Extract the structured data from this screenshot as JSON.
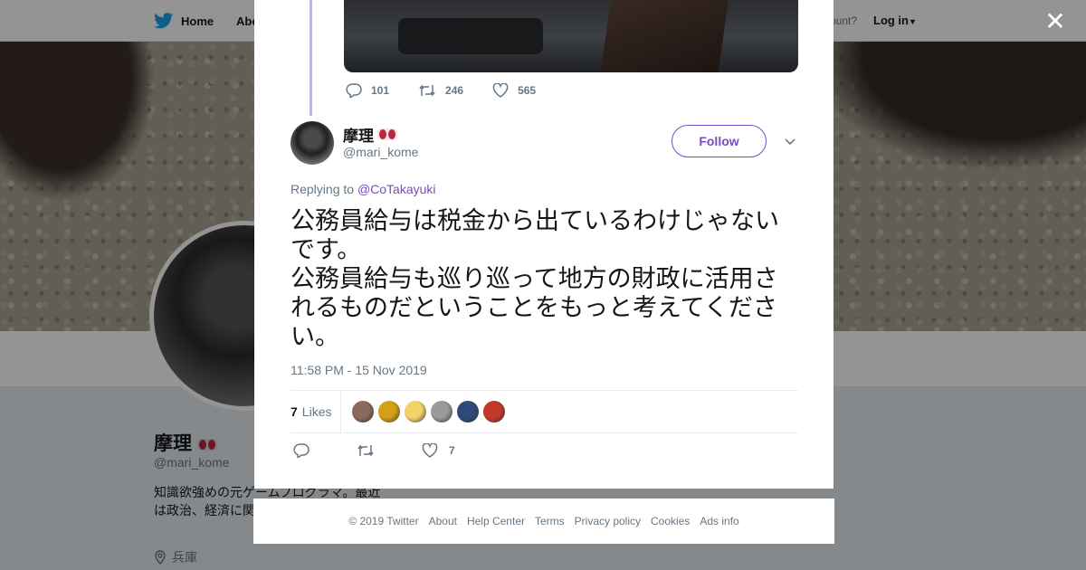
{
  "topbar": {
    "home_label": "Home",
    "about_label": "Abo",
    "account_prompt": "ccount?",
    "login_label": "Log in"
  },
  "profile": {
    "name": "摩理",
    "handle": "@mari_kome",
    "bio": "知識欲強めの元ゲームプログラマ。最近は政治、経済に関しいTweetが増え",
    "location": "兵庫"
  },
  "previous_tweet": {
    "reply_count": "101",
    "retweet_count": "246",
    "like_count": "565"
  },
  "tweet": {
    "author_name": "摩理",
    "author_handle": "@mari_kome",
    "follow_label": "Follow",
    "replying_prefix": "Replying to",
    "replying_handle": "@CoTakayuki",
    "text": "公務員給与は税金から出ているわけじゃないです。\n公務員給与も巡り巡って地方の財政に活用されるものだということをもっと考えてください。",
    "timestamp": "11:58 PM - 15 Nov 2019",
    "likes_count": "7",
    "likes_label": "Likes",
    "action_like_count": "7"
  },
  "likers": [
    {
      "color": "#8a6a5a"
    },
    {
      "color": "#d4a017"
    },
    {
      "color": "#f2d36b"
    },
    {
      "color": "#9a9a9a"
    },
    {
      "color": "#2d4a7a"
    },
    {
      "color": "#c0392b"
    }
  ],
  "footer": {
    "copyright": "© 2019 Twitter",
    "about": "About",
    "help": "Help Center",
    "terms": "Terms",
    "privacy": "Privacy policy",
    "cookies": "Cookies",
    "ads": "Ads info"
  },
  "colors": {
    "accent": "#794bc4",
    "muted": "#657786",
    "twitter_blue": "#1da1f2"
  }
}
